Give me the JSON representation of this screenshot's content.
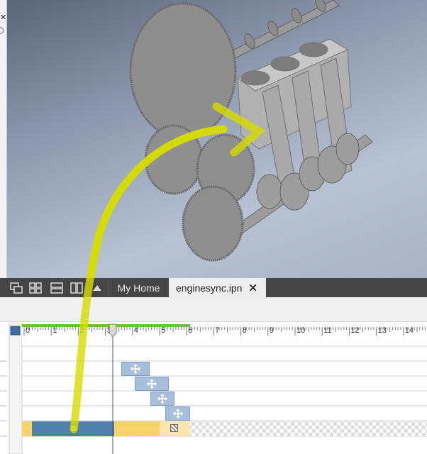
{
  "tabs": {
    "home_label": "My Home",
    "doc_label": "enginesync.ipn",
    "close_glyph": "✕"
  },
  "side": {
    "close_glyph": "✕"
  },
  "timeline": {
    "ticks": [
      "0",
      "1",
      "2",
      "3",
      "4",
      "5",
      "6",
      "7",
      "8",
      "9",
      "10",
      "11",
      "12",
      "13",
      "14"
    ],
    "playhead_time": 3.2,
    "colors": {
      "blue": "#4f80b0",
      "yellow": "#f8d36a",
      "action": "#a8bfdc",
      "green": "#6bc043"
    }
  }
}
